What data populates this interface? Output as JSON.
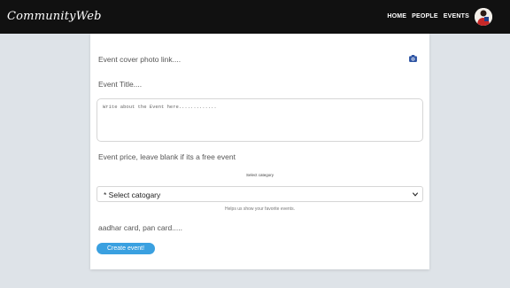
{
  "navbar": {
    "brand": "CommunityWeb",
    "links": [
      "HOME",
      "PEOPLE",
      "EVENTS"
    ]
  },
  "form": {
    "cover_photo_placeholder": "Event cover photo link....",
    "title_placeholder": "Event Title....",
    "description_placeholder": "Write about the Event here.............",
    "price_placeholder": "Event price, leave blank if its a free event",
    "category_label": "Select category",
    "category_selected": "* Select catogary",
    "category_helper": "Helps us show your favorite events.",
    "id_placeholder": "aadhar card, pan card.....",
    "submit_label": "Create event!"
  },
  "icons": {
    "camera": "camera-icon",
    "chevron": "chevron-down-icon",
    "avatar": "user-avatar"
  },
  "colors": {
    "navbar_bg": "#111111",
    "page_bg": "#dee3e8",
    "accent": "#3aa0e0",
    "camera_icon": "#2f55a4"
  }
}
